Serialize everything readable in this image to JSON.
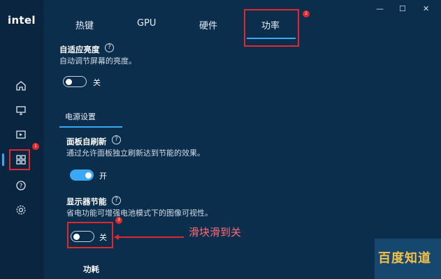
{
  "app": {
    "logo": "intel"
  },
  "window_controls": {
    "minimize": "—",
    "maximize": "☐",
    "close": "✕"
  },
  "tabs": [
    {
      "label": "热键"
    },
    {
      "label": "GPU"
    },
    {
      "label": "硬件"
    },
    {
      "label": "功率"
    }
  ],
  "sidebar": {
    "icons": [
      "home-icon",
      "display-icon",
      "media-icon",
      "apps-grid-icon",
      "help-icon",
      "settings-icon"
    ]
  },
  "adaptive_brightness": {
    "title": "自适应亮度",
    "description": "自动调节屏幕的亮度。",
    "toggle_label": "关"
  },
  "power_settings": {
    "tab_label": "电源设置"
  },
  "panel_self_refresh": {
    "title": "面板自刷新",
    "description": "通过允许面板独立刷新达到节能的效果。",
    "toggle_label": "开"
  },
  "display_power_saving": {
    "title": "显示器节能",
    "description": "省电功能可增强电池模式下的图像可视性。",
    "toggle_label": "关"
  },
  "power_consumption": {
    "title": "功耗"
  },
  "annotations": {
    "badge_1": "1",
    "badge_2": "2",
    "badge_3": "3",
    "slider_note": "滑块滑到关"
  },
  "watermark": {
    "text": "百度知道"
  },
  "colors": {
    "accent": "#3ba8f5",
    "annotation": "#e0282e",
    "background": "#0c2e4d"
  }
}
